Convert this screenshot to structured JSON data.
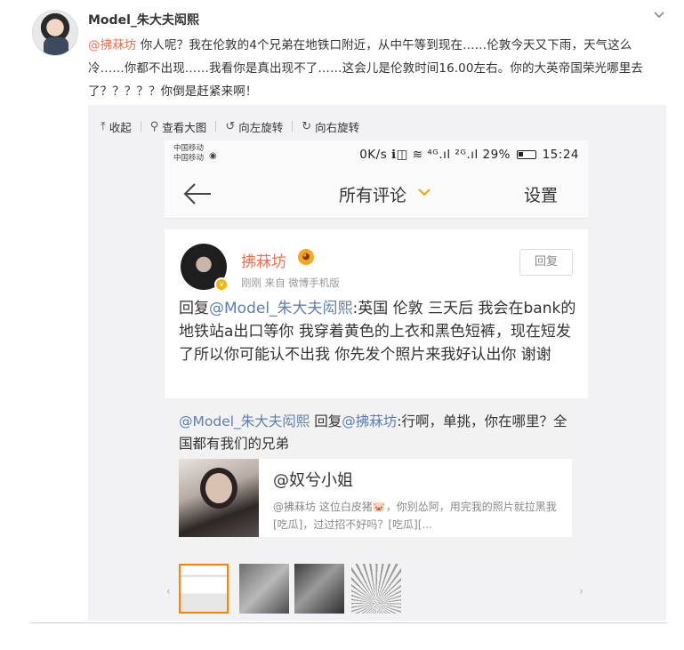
{
  "post": {
    "author": "Model_朱大夫闳熙",
    "text_mention": "@拂菻坊",
    "text_body": " 你人呢？我在伦敦的4个兄弟在地铁口附近，从中午等到现在……伦敦今天又下雨，天气这么冷……你都不出现……我看你是真出现不了……这会儿是伦敦时间16.00左右。你的大英帝国荣光哪里去了？？？？？你倒是赶紧来啊！"
  },
  "toolbar": {
    "collapse": "收起",
    "view_large": "查看大图",
    "rotate_left": "向左旋转",
    "rotate_right": "向右旋转"
  },
  "phone": {
    "carrier_1": "中国移动",
    "carrier_2": "中国移动",
    "status_left": "0K/s ℹ◫ ",
    "status_signal": "⁴ᴳ.ıl ²ᴳ.ıl 29%",
    "battery_level": 0.29,
    "time": "15:24",
    "nav_title": "所有评论",
    "nav_settings": "设置",
    "comment": {
      "name": "拂菻坊",
      "meta": "刚刚  来自 微博手机版",
      "reply_button": "回复",
      "body_prefix": "回复",
      "body_mention": "@Model_朱大夫闳熙",
      "body_text": ":英国 伦敦 三天后 我会在bank的地铁站a出口等你 我穿着黄色的上衣和黑色短裤，现在短发了所以你可能认不出我 你先发个照片来我好认出你 谢谢"
    },
    "reply": {
      "mention_1": "@Model_朱大夫闳熙",
      "mid": " 回复",
      "mention_2": "@拂菻坊",
      "text": ":行啊，单挑，你在哪里？全国都有我们的兄弟",
      "card_title": "@奴兮小姐",
      "card_desc": "@拂菻坊 这位白皮猪🐷，你别怂阿，用完我的照片就拉黑我[吃瓜]，过过招不好吗？[吃瓜][..."
    }
  },
  "strip": {
    "prev": "‹",
    "next": "›"
  },
  "colors": {
    "mention": "#eb7350",
    "link_blue": "#5d7fb0",
    "active_thumb": "#ff8200"
  }
}
